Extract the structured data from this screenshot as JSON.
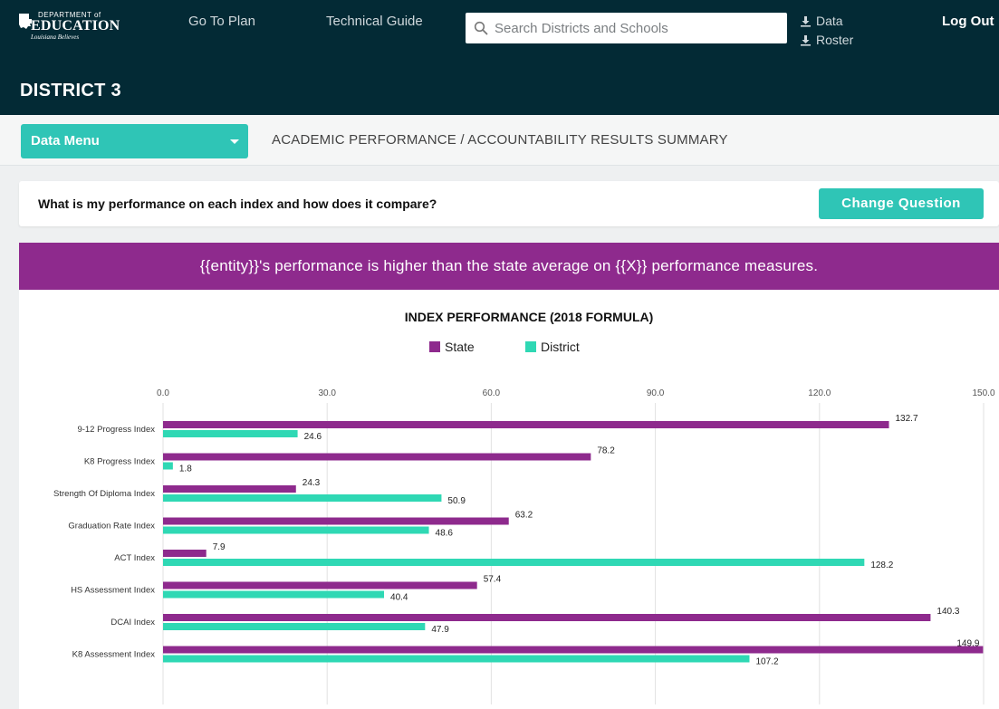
{
  "header": {
    "logo": {
      "line1": "DEPARTMENT of",
      "line2": "EDUCATION",
      "line3": "Louisiana Believes"
    },
    "nav": [
      {
        "label": "Go To Plan"
      },
      {
        "label": "Technical Guide"
      }
    ],
    "search": {
      "placeholder": "Search Districts and Schools",
      "value": ""
    },
    "downloads": [
      {
        "label": "Data",
        "icon": "download-icon"
      },
      {
        "label": "Roster",
        "icon": "download-icon"
      }
    ],
    "logout_label": "Log Out",
    "district_name": "DISTRICT 3"
  },
  "subbar": {
    "data_menu_label": "Data Menu",
    "breadcrumb": "ACADEMIC PERFORMANCE / ACCOUNTABILITY RESULTS SUMMARY"
  },
  "question": {
    "text": "What is my performance on each index and how does it compare?",
    "change_label": "Change Question"
  },
  "banner": {
    "text": "{{entity}}'s performance is higher than the state average on {{X}} performance measures."
  },
  "colors": {
    "header_bg": "#032a35",
    "accent": "#2fc5b6",
    "banner": "#8e2a8d",
    "state": "#8e2a8d",
    "district": "#2fd8b4"
  },
  "chart_data": {
    "type": "bar",
    "orientation": "horizontal",
    "title": "INDEX PERFORMANCE (2018 FORMULA)",
    "legend_position": "top",
    "xlim": [
      0,
      150
    ],
    "xticks": [
      "0.0",
      "30.0",
      "60.0",
      "90.0",
      "120.0",
      "150.0"
    ],
    "grid": true,
    "categories": [
      "9-12 Progress Index",
      "K8 Progress Index",
      "Strength Of Diploma Index",
      "Graduation Rate Index",
      "ACT Index",
      "HS Assessment Index",
      "DCAI Index",
      "K8 Assessment Index"
    ],
    "series": [
      {
        "name": "State",
        "color": "#8e2a8d",
        "values": [
          132.7,
          78.2,
          24.3,
          63.2,
          7.9,
          57.4,
          140.3,
          149.9
        ]
      },
      {
        "name": "District",
        "color": "#2fd8b4",
        "values": [
          24.6,
          1.8,
          50.9,
          48.6,
          128.2,
          40.4,
          47.9,
          107.2
        ]
      }
    ]
  }
}
